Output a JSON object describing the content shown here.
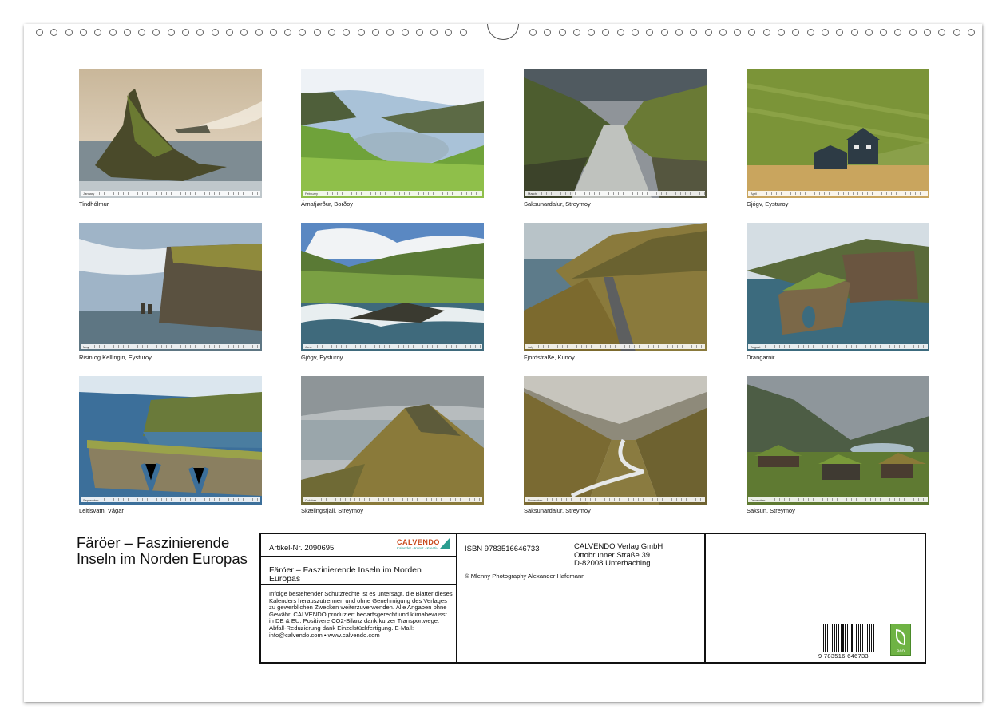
{
  "page": {
    "title": "Färöer – Faszinierende Inseln im Norden Europas"
  },
  "months": [
    {
      "label": "January",
      "caption": "Tindhólmur"
    },
    {
      "label": "February",
      "caption": "Árnafjørður, Borðoy"
    },
    {
      "label": "March",
      "caption": "Saksunardalur, Streymoy"
    },
    {
      "label": "April",
      "caption": "Gjógv, Eysturoy"
    },
    {
      "label": "May",
      "caption": "Risin og Kellingin, Eysturoy"
    },
    {
      "label": "June",
      "caption": "Gjógv, Eysturoy"
    },
    {
      "label": "July",
      "caption": "Fjordstraße, Kunoy"
    },
    {
      "label": "August",
      "caption": "Drangarnir"
    },
    {
      "label": "September",
      "caption": "Leitisvatn, Vágar"
    },
    {
      "label": "October",
      "caption": "Skælingsfjall, Streymoy"
    },
    {
      "label": "November",
      "caption": "Saksunardalur, Streymoy"
    },
    {
      "label": "December",
      "caption": "Saksun, Streymoy"
    }
  ],
  "info": {
    "article": "Artikel-Nr. 2090695",
    "brand": "CALVENDO",
    "brand_sub": "Kalender · Kunst · Kreativ",
    "product_title": "Färöer – Faszinierende Inseln im Norden Europas",
    "legal_text": "Infolge bestehender Schutzrechte ist es untersagt, die Blätter dieses Kalenders herauszutrennen und ohne Genehmigung des Verlages zu gewerblichen Zwecken weiterzuverwenden. Alle Angaben ohne Gewähr. CALVENDO produziert bedarfsgerecht und klimabewusst in DE & EU. Positivere CO2-Bilanz dank kurzer Transportwege. Abfall-Reduzierung dank Einzelstückfertigung. E-Mail: info@calvendo.com • www.calvendo.com",
    "isbn": "ISBN 9783516646733",
    "publisher_line1": "CALVENDO Verlag GmbH",
    "publisher_line2": "Ottobrunner Straße 39",
    "publisher_line3": "D-82008 Unterhaching",
    "copyright": "© Mlenny Photography Alexander Hafemann",
    "barcode_number": "9 783516 646733",
    "eco_label": "eco"
  },
  "icons": {
    "eco": "leaf-icon",
    "brand": "calvendo-logo-icon"
  }
}
